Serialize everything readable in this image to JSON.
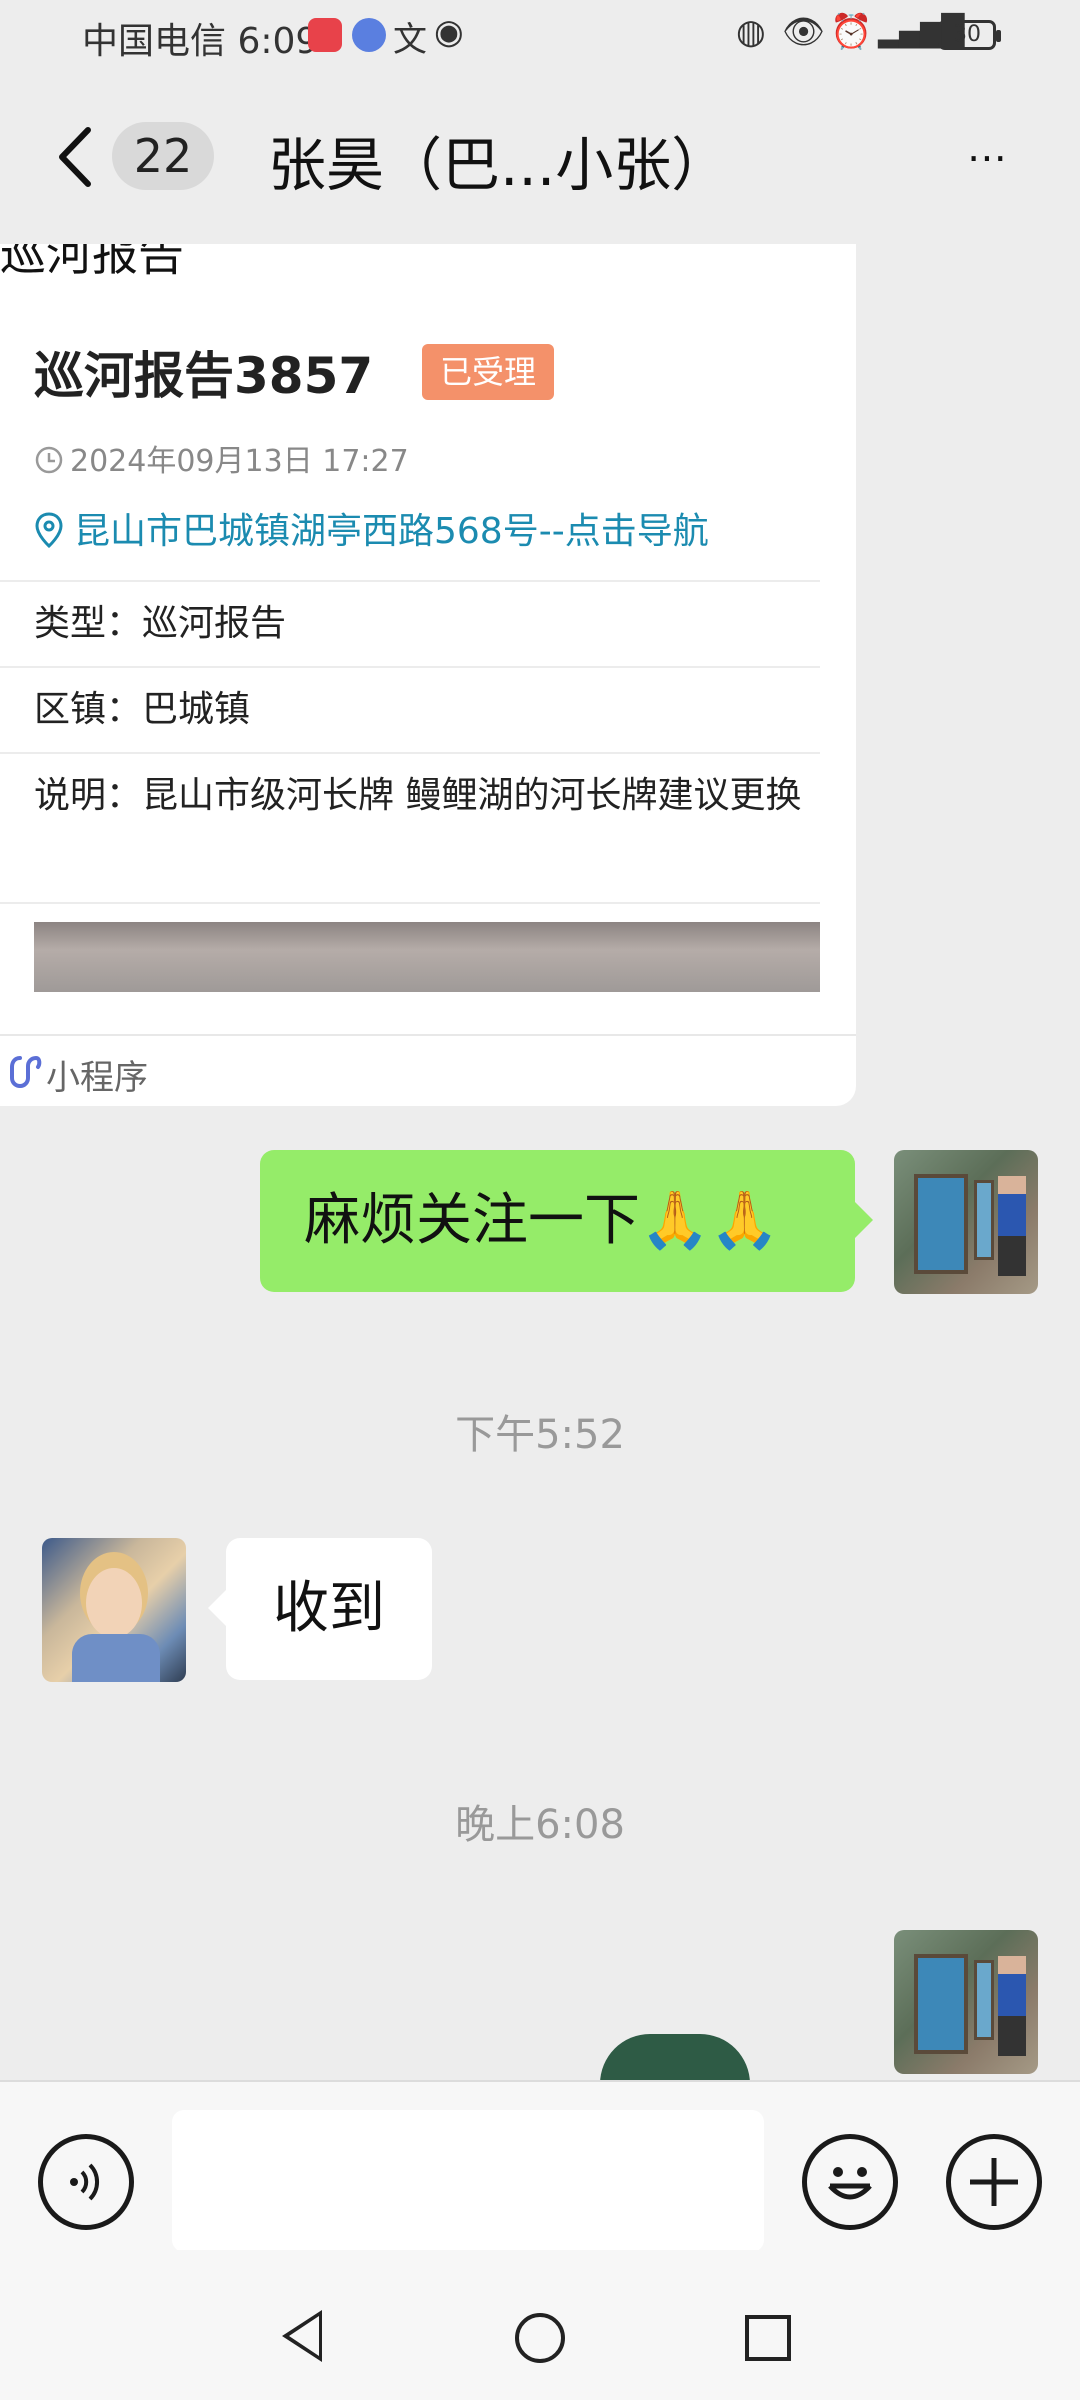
{
  "status_bar": {
    "carrier_time": "中国电信 6:09",
    "battery": "30"
  },
  "header": {
    "unread_count": "22",
    "title": "张昊（巴...小张）",
    "more_icon": "⋯"
  },
  "card": {
    "cut_off_title": "巡河报告",
    "title": "巡河报告3857",
    "status_tag": "已受理",
    "time": "2024年09月13日 17:27",
    "address": "昆山市巴城镇湖亭西路568号--点击导航",
    "type_line": "类型：巡河报告",
    "district_line": "区镇：巴城镇",
    "desc_line": "说明：昆山市级河长牌 鳗鲤湖的河长牌建议更换",
    "source_label": "小程序"
  },
  "messages": {
    "outgoing_text": "麻烦关注一下🙏🙏",
    "timestamp_1": "下午5:52",
    "incoming_text": "收到",
    "timestamp_2": "晚上6:08"
  },
  "colors": {
    "outgoing_bubble": "#95ec69",
    "status_tag": "#f4916a",
    "address_link": "#1b8bb0",
    "background": "#ededed"
  },
  "icons": {
    "back": "chevron-left-icon",
    "more": "more-horizontal-icon",
    "clock": "clock-icon",
    "location": "location-pin-icon",
    "mini_program": "link-icon",
    "voice": "voice-icon",
    "emoji": "emoji-icon",
    "plus": "plus-icon"
  }
}
